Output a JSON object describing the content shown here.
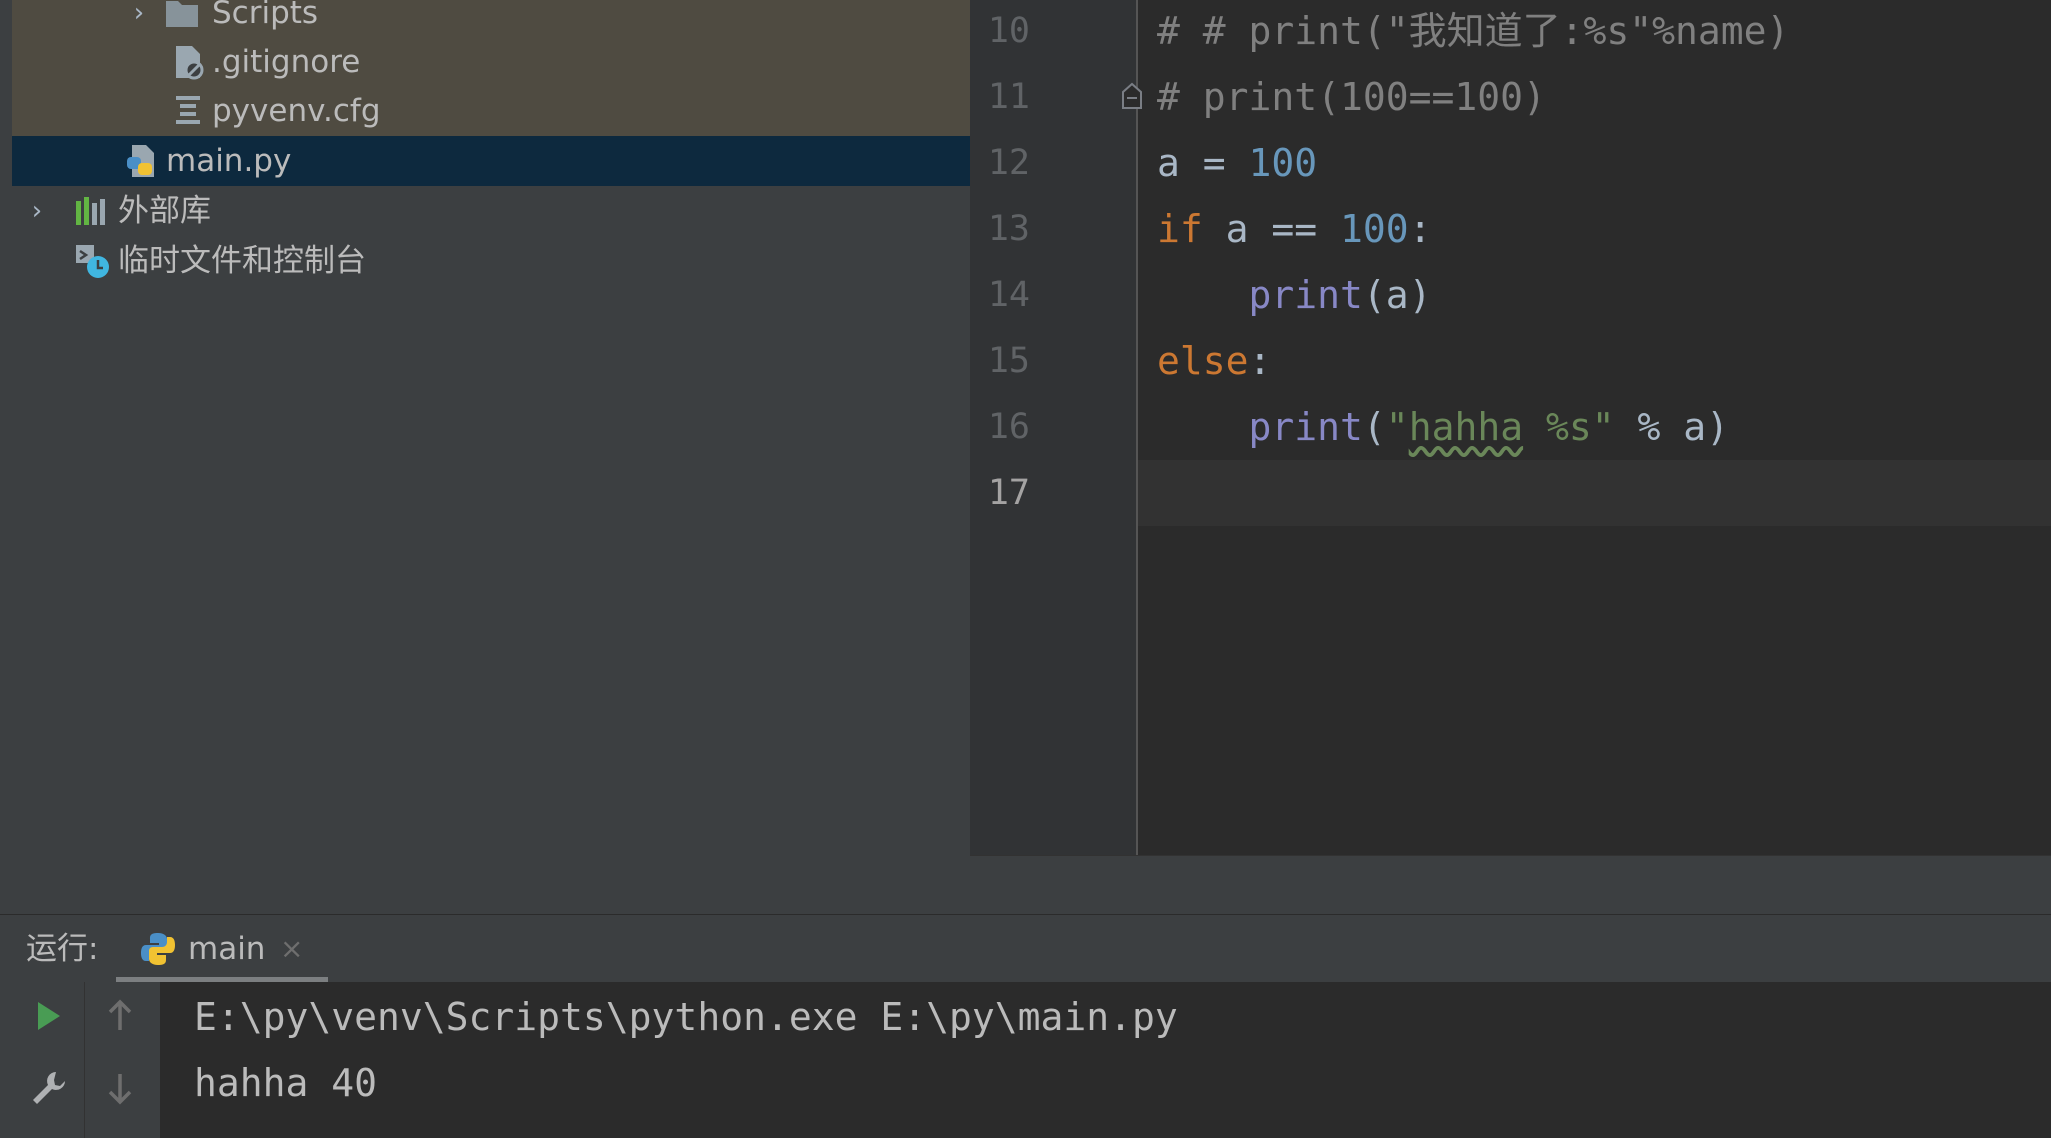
{
  "project_tree": {
    "items": [
      {
        "label": "Scripts",
        "icon": "folder-icon"
      },
      {
        "label": ".gitignore",
        "icon": "ignored-file-icon"
      },
      {
        "label": "pyvenv.cfg",
        "icon": "config-file-icon"
      },
      {
        "label": "main.py",
        "icon": "python-file-icon",
        "selected": true
      },
      {
        "label": "外部库",
        "icon": "library-icon"
      },
      {
        "label": "临时文件和控制台",
        "icon": "scratches-icon"
      }
    ]
  },
  "editor": {
    "line_numbers": [
      "10",
      "11",
      "12",
      "13",
      "14",
      "15",
      "16",
      "17"
    ],
    "current_line": "17",
    "lines": [
      [
        {
          "t": "# # print(\"我知道了:%s\"%name)",
          "c": "com"
        }
      ],
      [
        {
          "t": "# print(100==100)",
          "c": "com"
        }
      ],
      [
        {
          "t": "a = ",
          "c": "plain"
        },
        {
          "t": "100",
          "c": "num"
        }
      ],
      [
        {
          "t": "if",
          "c": "kw"
        },
        {
          "t": " a == ",
          "c": "plain"
        },
        {
          "t": "100",
          "c": "num"
        },
        {
          "t": ":",
          "c": "plain"
        }
      ],
      [
        {
          "t": "    ",
          "c": "plain"
        },
        {
          "t": "print",
          "c": "fn"
        },
        {
          "t": "(a)",
          "c": "plain"
        }
      ],
      [
        {
          "t": "else",
          "c": "kw"
        },
        {
          "t": ":",
          "c": "plain"
        }
      ],
      [
        {
          "t": "    ",
          "c": "plain"
        },
        {
          "t": "print",
          "c": "fn"
        },
        {
          "t": "(",
          "c": "plain"
        },
        {
          "t": "\"",
          "c": "str"
        },
        {
          "t": "hahha",
          "c": "str typo"
        },
        {
          "t": " %s\"",
          "c": "str"
        },
        {
          "t": " % a)",
          "c": "plain"
        }
      ],
      []
    ]
  },
  "run_panel": {
    "title": "运行:",
    "tab_label": "main",
    "tab_close": "×",
    "console_lines": [
      "E:\\py\\venv\\Scripts\\python.exe E:\\py\\main.py",
      "hahha 40"
    ]
  },
  "colors": {
    "keyword": "#cc7832",
    "number": "#6897bb",
    "string": "#6a8759",
    "builtin": "#8888c6",
    "comment": "#808080",
    "selection": "#0d293e"
  }
}
